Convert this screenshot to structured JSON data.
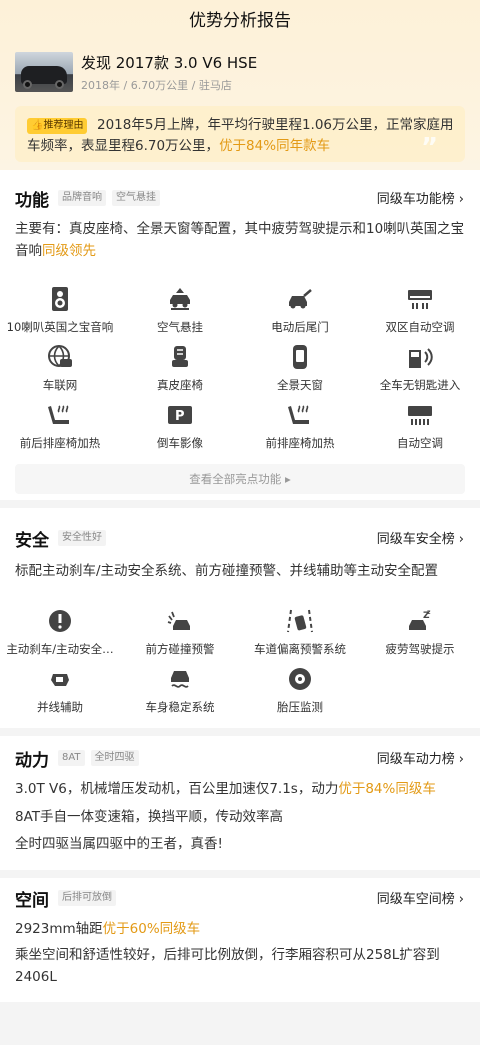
{
  "header": {
    "title": "优势分析报告"
  },
  "car": {
    "title": "发现 2017款 3.0 V6 HSE",
    "subtitle": "2018年 / 6.70万公里 / 驻马店"
  },
  "reason": {
    "tag": "推荐理由",
    "text": "2018年5月上牌，年平均行驶里程1.06万公里，正常家庭用车频率，表显里程6.70万公里，",
    "highlight": "优于84%同年款车"
  },
  "function": {
    "title": "功能",
    "tags": [
      "品牌音响",
      "空气悬挂"
    ],
    "rank": "同级车功能榜",
    "desc": "主要有：真皮座椅、全景天窗等配置，其中疲劳驾驶提示和10喇叭英国之宝音响",
    "desc_highlight": "同级领先",
    "features": [
      {
        "label": "10喇叭英国之宝音响",
        "icon": "speaker-icon"
      },
      {
        "label": "空气悬挂",
        "icon": "air-suspension-icon"
      },
      {
        "label": "电动后尾门",
        "icon": "power-tailgate-icon"
      },
      {
        "label": "双区自动空调",
        "icon": "dual-zone-ac-icon"
      },
      {
        "label": "车联网",
        "icon": "connected-car-icon"
      },
      {
        "label": "真皮座椅",
        "icon": "leather-seat-icon"
      },
      {
        "label": "全景天窗",
        "icon": "panoramic-sunroof-icon"
      },
      {
        "label": "全车无钥匙进入",
        "icon": "keyless-entry-icon"
      },
      {
        "label": "前后排座椅加热",
        "icon": "seat-heating-icon"
      },
      {
        "label": "倒车影像",
        "icon": "reverse-camera-icon"
      },
      {
        "label": "前排座椅加热",
        "icon": "front-seat-heating-icon"
      },
      {
        "label": "自动空调",
        "icon": "auto-ac-icon"
      }
    ],
    "more": "查看全部亮点功能"
  },
  "safety": {
    "title": "安全",
    "tags": [
      "安全性好"
    ],
    "rank": "同级车安全榜",
    "desc": "标配主动刹车/主动安全系统、前方碰撞预警、并线辅助等主动安全配置",
    "features": [
      {
        "label": "主动刹车/主动安全…",
        "icon": "active-brake-icon"
      },
      {
        "label": "前方碰撞预警",
        "icon": "collision-warning-icon"
      },
      {
        "label": "车道偏离预警系统",
        "icon": "lane-departure-icon"
      },
      {
        "label": "疲劳驾驶提示",
        "icon": "fatigue-driving-icon"
      },
      {
        "label": "并线辅助",
        "icon": "blind-spot-icon"
      },
      {
        "label": "车身稳定系统",
        "icon": "stability-control-icon"
      },
      {
        "label": "胎压监测",
        "icon": "tire-pressure-icon"
      }
    ]
  },
  "power": {
    "title": "动力",
    "tags": [
      "8AT",
      "全时四驱"
    ],
    "rank": "同级车动力榜",
    "line1": "3.0T V6，机械增压发动机，百公里加速仅7.1s，动力",
    "line1_highlight": "优于84%同级车",
    "line2": "8AT手自一体变速箱，换挡平顺，传动效率高",
    "line3": "全时四驱当属四驱中的王者，真香!"
  },
  "space": {
    "title": "空间",
    "tags": [
      "后排可放倒"
    ],
    "rank": "同级车空间榜",
    "line1": "2923mm轴距",
    "line1_highlight": "优于60%同级车",
    "line2": "乘坐空间和舒适性较好，后排可比例放倒，行李厢容积可从258L扩容到2406L"
  },
  "colors": {
    "accent": "#e39a16",
    "tag": "#ffcc33"
  }
}
